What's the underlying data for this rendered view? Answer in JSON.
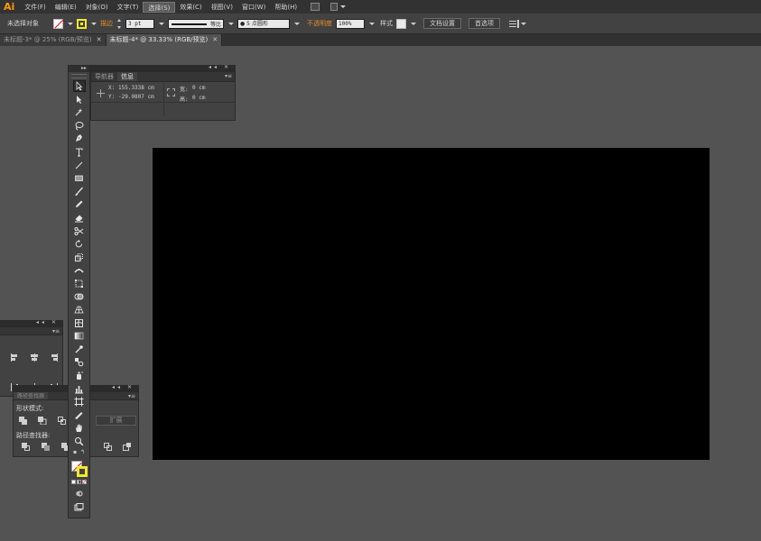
{
  "app": {
    "logo": "Ai"
  },
  "menu": [
    "文件(F)",
    "编辑(E)",
    "对象(O)",
    "文字(T)",
    "选择(S)",
    "效果(C)",
    "视图(V)",
    "窗口(W)",
    "帮助(H)"
  ],
  "control_bar": {
    "selection_status": "未选择对象",
    "stroke_label": "描边",
    "stroke_weight": "3 pt",
    "stroke_profile": "等比",
    "brush": "● 5 点圆形",
    "opacity_label": "不透明度",
    "opacity_value": "100%",
    "style_label": "样式",
    "doc_setup_button": "文档设置",
    "preferences_button": "首选项"
  },
  "tabs": [
    {
      "label": "未标题-3* @ 25% (RGB/预览)",
      "close": "✕",
      "active": false
    },
    {
      "label": "未标题-4* @ 33.33% (RGB/预览)",
      "close": "✕",
      "active": true
    }
  ],
  "info_panel": {
    "tabs": [
      "导航器",
      "信息"
    ],
    "x_label": "X:",
    "x_value": "155.3338 cm",
    "y_label": "Y:",
    "y_value": "-29.0807 cm",
    "w_label": "宽:",
    "w_value": "0 cm",
    "h_label": "高:",
    "h_value": "0 cm"
  },
  "pathfinder_panel": {
    "title": "路径查找器",
    "shape_modes_label": "形状模式:",
    "pathfinders_label": "路径查找器:",
    "expand_button": "扩展"
  },
  "colors": {
    "app_bg": "#535353",
    "menubar_bg": "#323232",
    "panel_bg": "#424242",
    "accent_orange": "#ff9a00",
    "label_orange": "#e58b2b",
    "stroke_yellow": "#f2e82b",
    "artboard": "#000000"
  }
}
